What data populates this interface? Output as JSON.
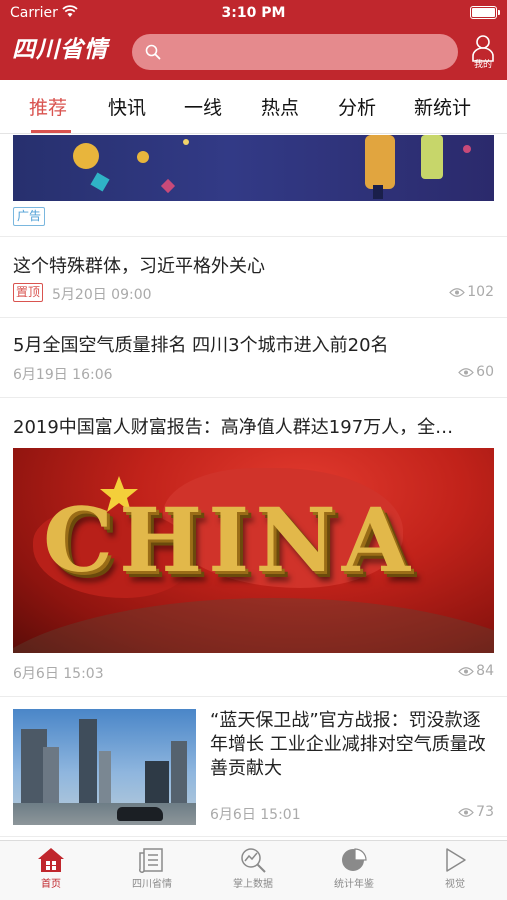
{
  "status_bar": {
    "carrier": "Carrier",
    "time": "3:10 PM"
  },
  "header": {
    "logo": "四川省情",
    "search_placeholder": "",
    "profile_label": "我的",
    "accent_color": "#c0272d"
  },
  "tabs": [
    {
      "label": "推荐",
      "active": true
    },
    {
      "label": "快讯"
    },
    {
      "label": "一线"
    },
    {
      "label": "热点"
    },
    {
      "label": "分析"
    },
    {
      "label": "新统计"
    }
  ],
  "feed": {
    "ad": {
      "badge": "广告"
    },
    "articles": [
      {
        "title": "这个特殊群体，习近平格外关心",
        "badge": "置顶",
        "time": "5月20日 09:00",
        "views": "102"
      },
      {
        "title": "5月全国空气质量排名 四川3个城市进入前20名",
        "time": "6月19日 16:06",
        "views": "60"
      },
      {
        "title": "2019中国富人财富报告：高净值人群达197万人，全…",
        "image_text": "CHINA",
        "time": "6月6日 15:03",
        "views": "84"
      },
      {
        "title": "“蓝天保卫战”官方战报：罚没款逐年增长 工业企业减排对空气质量改善贡献大",
        "time": "6月6日 15:01",
        "views": "73"
      }
    ]
  },
  "bottom_nav": [
    {
      "label": "首页",
      "icon": "home-icon",
      "active": true
    },
    {
      "label": "四川省情",
      "icon": "newspaper-icon"
    },
    {
      "label": "掌上数据",
      "icon": "magnifier-chart-icon"
    },
    {
      "label": "统计年鉴",
      "icon": "pie-chart-icon"
    },
    {
      "label": "视觉",
      "icon": "play-icon"
    }
  ]
}
